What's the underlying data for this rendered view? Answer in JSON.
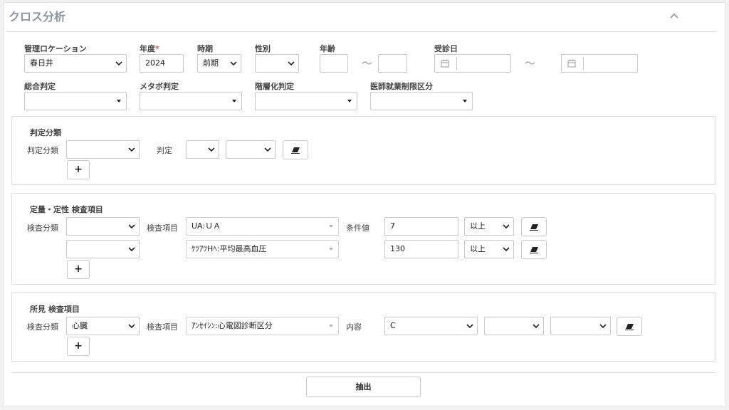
{
  "header": {
    "title": "クロス分析"
  },
  "filters": {
    "location": {
      "label": "管理ロケーション",
      "value": "春日井"
    },
    "year": {
      "label": "年度",
      "required_mark": "*",
      "value": "2024"
    },
    "period": {
      "label": "時期",
      "value": "前期"
    },
    "gender": {
      "label": "性別",
      "value": ""
    },
    "age": {
      "label": "年齢",
      "from": "",
      "to": "",
      "separator": "〜"
    },
    "visit_date": {
      "label": "受診日",
      "from": "",
      "to": "",
      "separator": "〜"
    },
    "overall": {
      "label": "総合判定",
      "value": ""
    },
    "metabo": {
      "label": "メタボ判定",
      "value": ""
    },
    "stratified": {
      "label": "階層化判定",
      "value": ""
    },
    "doctor_limit": {
      "label": "医師就業制限区分",
      "value": ""
    }
  },
  "judgment": {
    "title": "判定分類",
    "category_label": "判定分類",
    "judgment_label": "判定",
    "category_value": "",
    "judge_1": "",
    "judge_2": ""
  },
  "quant": {
    "title": "定量・定性 検査項目",
    "category_label": "検査分類",
    "item_label": "検査項目",
    "condition_label": "条件値",
    "rows": [
      {
        "category": "",
        "item": "UA:ＵＡ",
        "value": "7",
        "op": "以上"
      },
      {
        "category": "",
        "item": "ｹﾂｱﾂHﾍ:平均最高血圧",
        "value": "130",
        "op": "以上"
      }
    ]
  },
  "findings": {
    "title": "所見 検査項目",
    "category_label": "検査分類",
    "item_label": "検査項目",
    "content_label": "内容",
    "category": "心臓",
    "item": "ｱﾝｾｲｼﾝ:心電図診断区分",
    "content_1": "C",
    "content_2": "",
    "content_3": ""
  },
  "actions": {
    "add": "+",
    "extract": "抽出"
  },
  "icons": {
    "collapse": "chevron-up-icon",
    "calendar": "calendar-icon",
    "clear": "eraser-icon",
    "dropdown": "caret-down-icon"
  }
}
